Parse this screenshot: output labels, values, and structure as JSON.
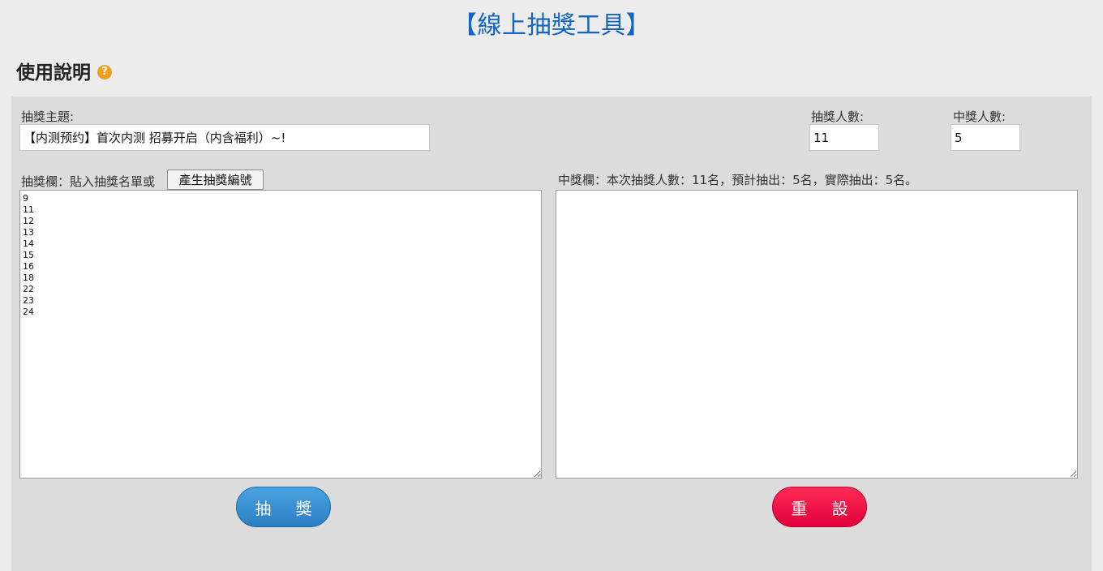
{
  "page": {
    "title": "【線上抽獎工具】"
  },
  "help": {
    "title": "使用說明",
    "icon": "question-circle-icon",
    "icon_glyph": "?",
    "icon_color": "#f0a020"
  },
  "form": {
    "subject_label": "抽獎主題:",
    "subject_value": "【内测预约】首次内测 招募开启（内含福利）~!",
    "entrants_label": "抽獎人數:",
    "entrants_value": "11",
    "winners_label": "中獎人數:",
    "winners_value": "5"
  },
  "draw_pool": {
    "label": "抽獎欄：貼入抽獎名單或",
    "generate_button": "產生抽獎編號",
    "entries": "9\n11\n12\n13\n14\n15\n16\n18\n22\n23\n24"
  },
  "winners_area": {
    "label": "中獎欄：本次抽獎人數：11名，預計抽出：5名，實際抽出：5名。",
    "value": ""
  },
  "actions": {
    "draw_button": "抽 獎",
    "reset_button": "重 設",
    "draw_color": "#2a7fc4",
    "reset_color": "#e0003a"
  }
}
